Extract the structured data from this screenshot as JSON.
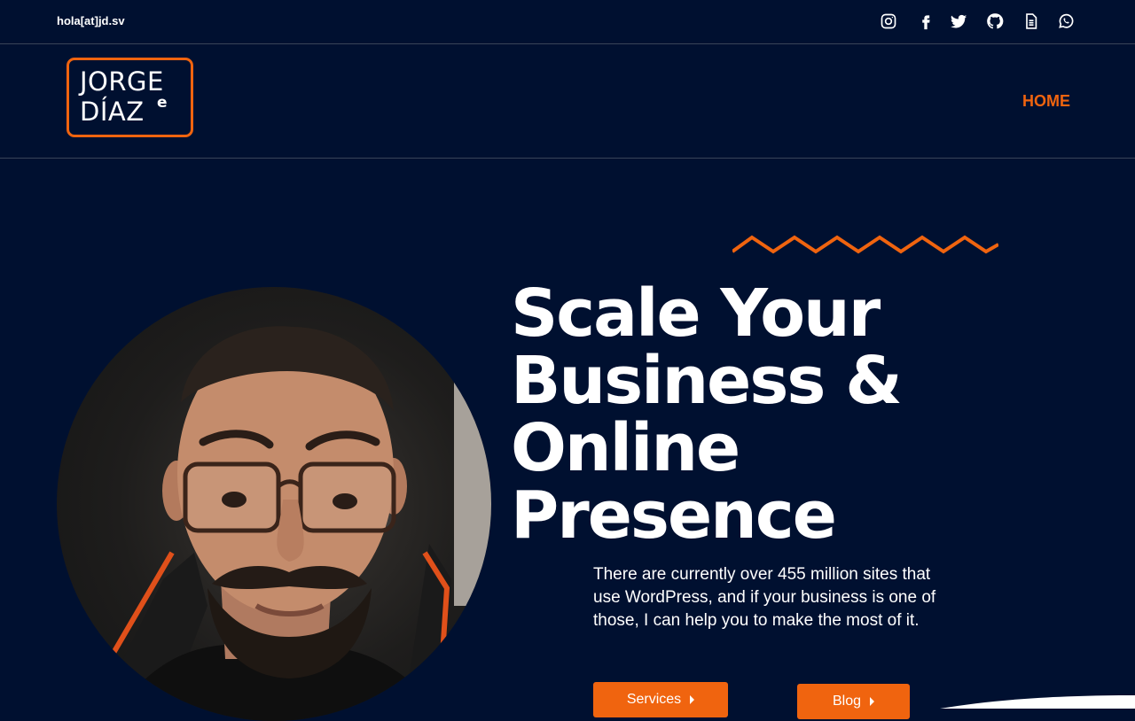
{
  "topbar": {
    "email": "hola[at]jd.sv",
    "social": [
      {
        "name": "instagram-icon"
      },
      {
        "name": "facebook-icon"
      },
      {
        "name": "twitter-icon"
      },
      {
        "name": "github-icon"
      },
      {
        "name": "document-icon"
      },
      {
        "name": "whatsapp-icon"
      }
    ]
  },
  "logo": {
    "line1": "JORGE",
    "line2": "DÍAZ",
    "sup": "e"
  },
  "nav": {
    "home": "HOME"
  },
  "hero": {
    "headline": [
      "Scale Your",
      "Business &",
      "Online",
      "Presence"
    ],
    "subtext": "There are currently over 455 million sites that use WordPress, and if your business is one of those, I can help you to make the most of it.",
    "buttons": {
      "services": "Services",
      "blog": "Blog"
    }
  },
  "colors": {
    "background": "#001030",
    "accent": "#f0640f",
    "text": "#ffffff"
  }
}
